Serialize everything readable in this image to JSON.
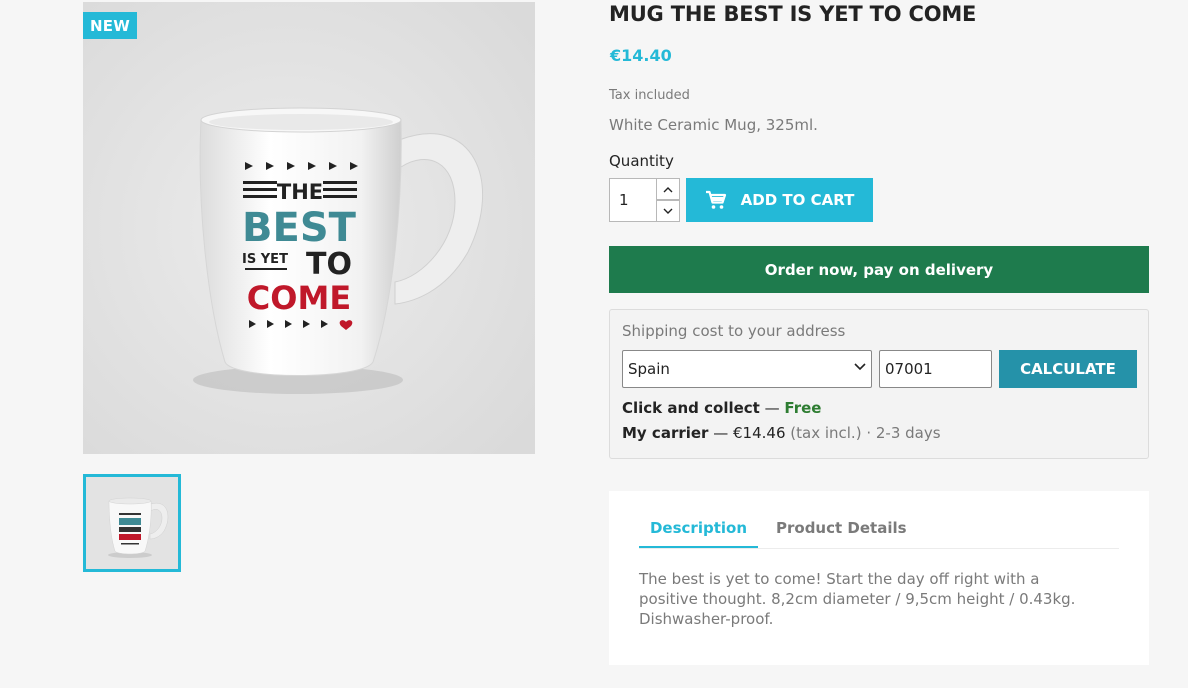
{
  "badges": {
    "new": "NEW"
  },
  "mug_art": {
    "line1": "THE",
    "line2": "BEST",
    "line3a": "IS YET",
    "line3b": "TO",
    "line4": "COME"
  },
  "product": {
    "title": "MUG THE BEST IS YET TO COME",
    "price": "€14.40",
    "tax_label": "Tax included",
    "short_description": "White Ceramic Mug, 325ml."
  },
  "purchase": {
    "quantity_label": "Quantity",
    "quantity_value": "1",
    "add_to_cart_label": "ADD TO CART",
    "order_now_label": "Order now, pay on delivery"
  },
  "shipping": {
    "title": "Shipping cost to your address",
    "country_selected": "Spain",
    "zip_value": "07001",
    "calculate_label": "CALCULATE",
    "options": [
      {
        "carrier": "Click and collect",
        "sep": " — ",
        "price": "Free"
      },
      {
        "carrier": "My carrier",
        "sep": " — ",
        "price": "€14.46",
        "tax_note": " (tax incl.)",
        "dot": " · ",
        "delay": "2-3 days"
      }
    ]
  },
  "tabs": [
    {
      "label": "Description"
    },
    {
      "label": "Product Details"
    }
  ],
  "description": "The best is yet to come! Start the day off right with a positive thought. 8,2cm diameter / 9,5cm height / 0.43kg. Dishwasher-proof.",
  "colors": {
    "accent": "#24b9d7",
    "order_green": "#1e7b4d",
    "calculate_blue": "#2592a9",
    "free_green": "#2e7d32",
    "mug_teal": "#3f8a94",
    "mug_red": "#c0182a"
  },
  "icons": {
    "cart": "shopping-cart-icon",
    "qty_up": "chevron-up-icon",
    "qty_down": "chevron-down-icon",
    "select": "chevron-down-icon"
  }
}
